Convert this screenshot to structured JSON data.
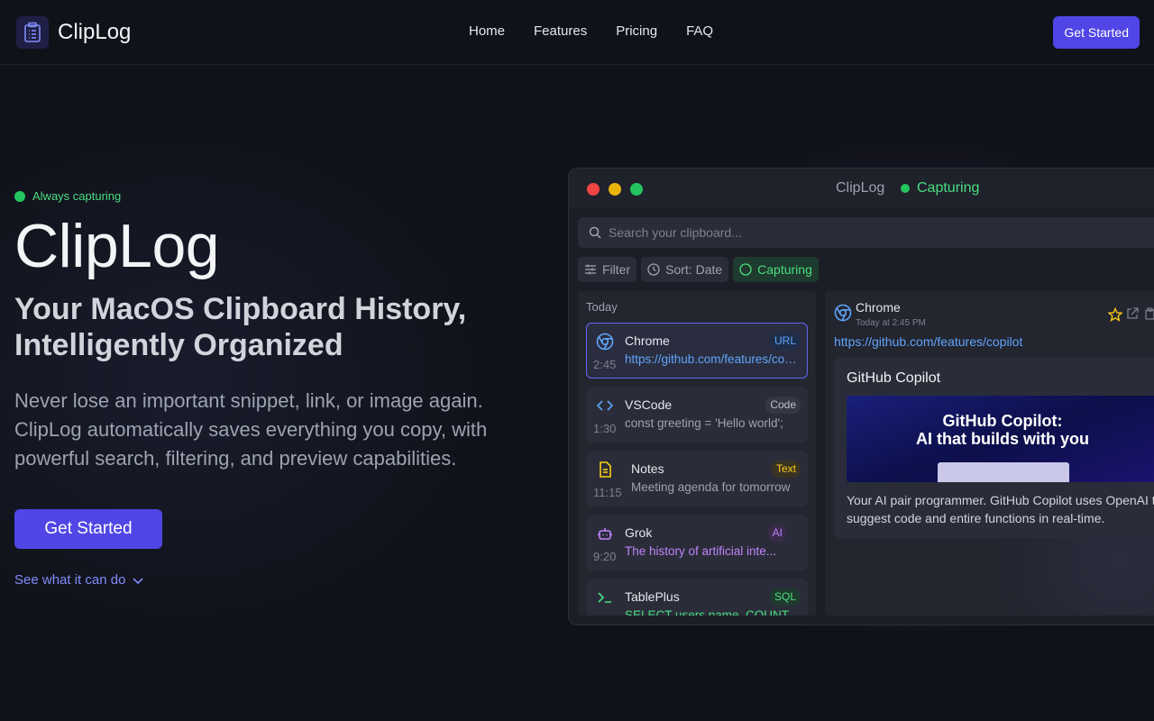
{
  "nav": {
    "brand": "ClipLog",
    "links": [
      "Home",
      "Features",
      "Pricing",
      "FAQ"
    ],
    "cta": "Get Started"
  },
  "hero": {
    "status": "Always capturing",
    "title": "ClipLog",
    "subtitle_line1": "Your MacOS Clipboard History,",
    "subtitle_line2": "Intelligently Organized",
    "description": "Never lose an important snippet, link, or image again. ClipLog automatically saves everything you copy, with powerful search, filtering, and preview capabilities.",
    "cta": "Get Started",
    "see_more": "See what it can do"
  },
  "window": {
    "title": "ClipLog",
    "status": "Capturing",
    "search_placeholder": "Search your clipboard...",
    "chips": {
      "filter": "Filter",
      "sort": "Sort: Date",
      "capturing": "Capturing"
    },
    "list_header": "Today",
    "items": [
      {
        "app": "Chrome",
        "time": "2:45",
        "preview": "https://github.com/features/copilot",
        "tag": "URL"
      },
      {
        "app": "VSCode",
        "time": "1:30",
        "preview": "const greeting = 'Hello world';",
        "tag": "Code"
      },
      {
        "app": "Notes",
        "time": "11:15",
        "preview": "Meeting agenda for tomorrow",
        "tag": "Text"
      },
      {
        "app": "Grok",
        "time": "9:20",
        "preview": "The history of artificial inte...",
        "tag": "AI"
      },
      {
        "app": "TablePlus",
        "time": "",
        "preview": "SELECT users.name, COUNT(*)",
        "tag": "SQL"
      }
    ],
    "detail": {
      "app": "Chrome",
      "time": "Today at 2:45 PM",
      "url": "https://github.com/features/copilot",
      "card_title": "GitHub Copilot",
      "image_line1": "GitHub Copilot:",
      "image_line2": "AI that builds with you",
      "card_desc": "Your AI pair programmer. GitHub Copilot uses OpenAI to suggest code and entire functions in real-time."
    }
  },
  "colors": {
    "accent": "#4f46e5",
    "green": "#22c55e",
    "url": "#60a5fa",
    "code": "#9ca3af",
    "text": "#facc15",
    "ai": "#c084fc",
    "sql": "#4ade80"
  }
}
